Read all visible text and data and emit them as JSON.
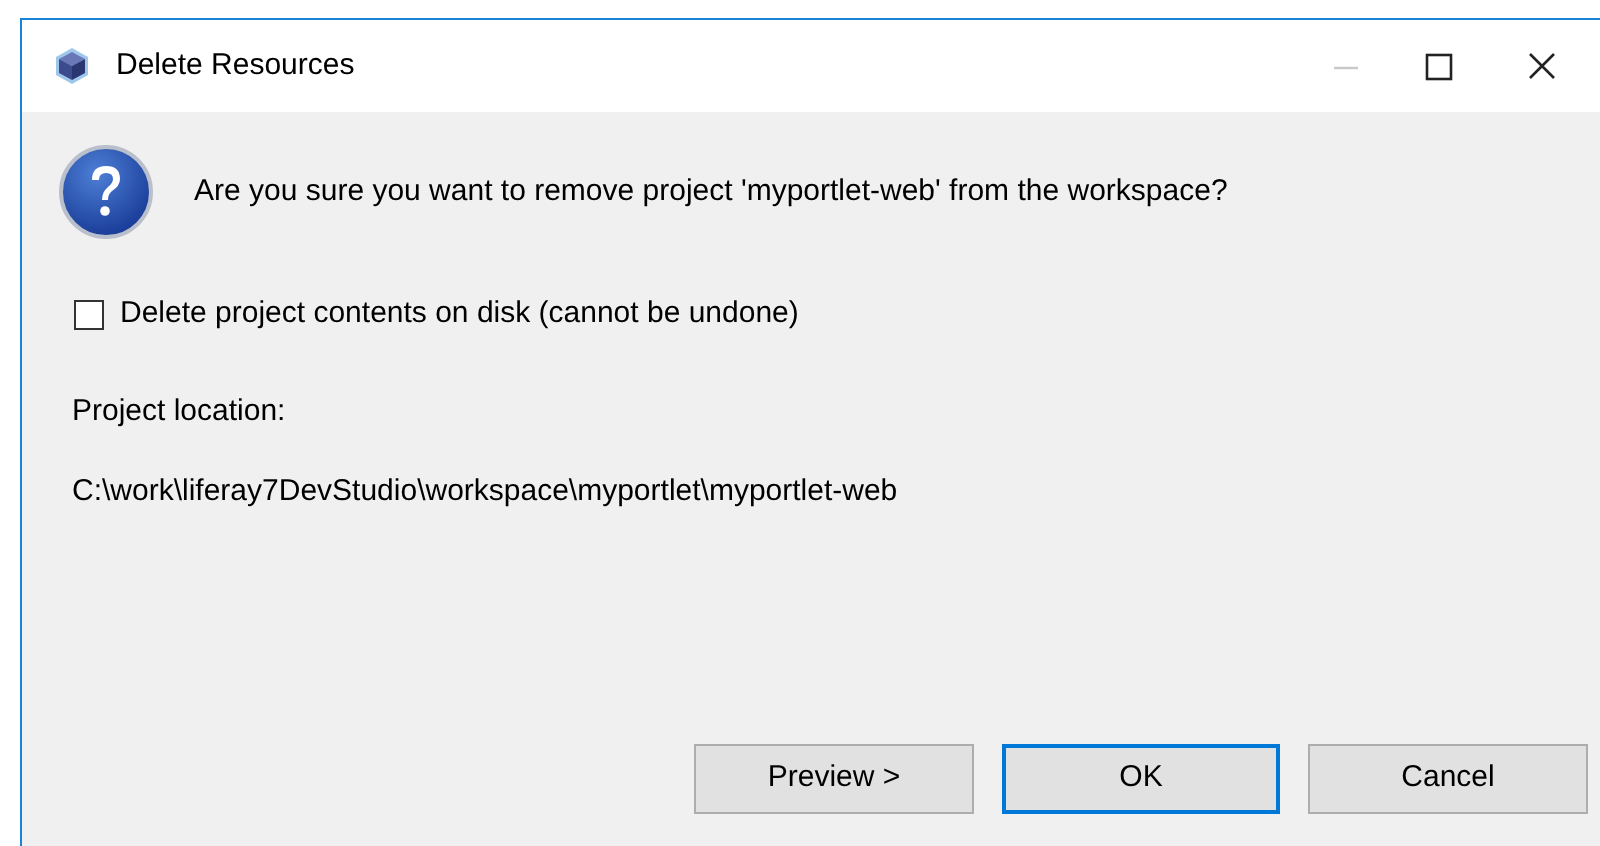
{
  "window": {
    "title": "Delete Resources",
    "minimize_disabled": true
  },
  "message": "Are you sure you want to remove project 'myportlet-web' from the workspace?",
  "delete_contents": {
    "label": "Delete project contents on disk (cannot be undone)",
    "checked": false
  },
  "location": {
    "label": "Project location:",
    "path": "C:\\work\\liferay7DevStudio\\workspace\\myportlet\\myportlet-web"
  },
  "buttons": [
    {
      "label": "Preview >",
      "default": false
    },
    {
      "label": "OK",
      "default": true
    },
    {
      "label": "Cancel",
      "default": false
    }
  ]
}
